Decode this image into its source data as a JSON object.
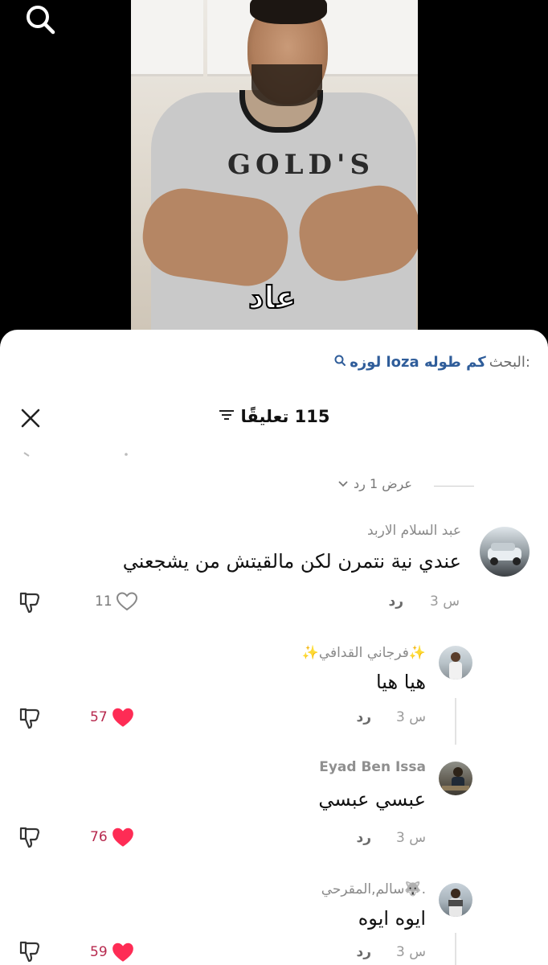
{
  "video": {
    "caption": "عاد",
    "shirt_logo": "GOLD'S"
  },
  "sheet": {
    "search_label": "البحث:",
    "search_query": "لوزه loza كم طوله",
    "title": "115 تعليقًا",
    "view_replies": "عرض 1 رد"
  },
  "comments": [
    {
      "author": "عبد السلام الاربد",
      "text": "عندي نية نتمرن لكن مالقيتش من يشجعني",
      "time": "3 س",
      "reply": "رد",
      "likes": "11",
      "liked": false
    },
    {
      "author": "✨فرجاني القدافي✨",
      "text": "هيا هيا",
      "time": "3 س",
      "reply": "رد",
      "likes": "57",
      "liked": true
    },
    {
      "author": "Eyad Ben Issa",
      "text": "عبسي عبسي",
      "time": "3 س",
      "reply": "رد",
      "likes": "76",
      "liked": true
    },
    {
      "author": "سالم,المقرحي🐺.",
      "text": "ايوه ايوه",
      "time": "3 س",
      "reply": "رد",
      "likes": "59",
      "liked": true
    }
  ],
  "colors": {
    "like_red": "#fe2c55",
    "link_blue": "#2f5d9a"
  }
}
